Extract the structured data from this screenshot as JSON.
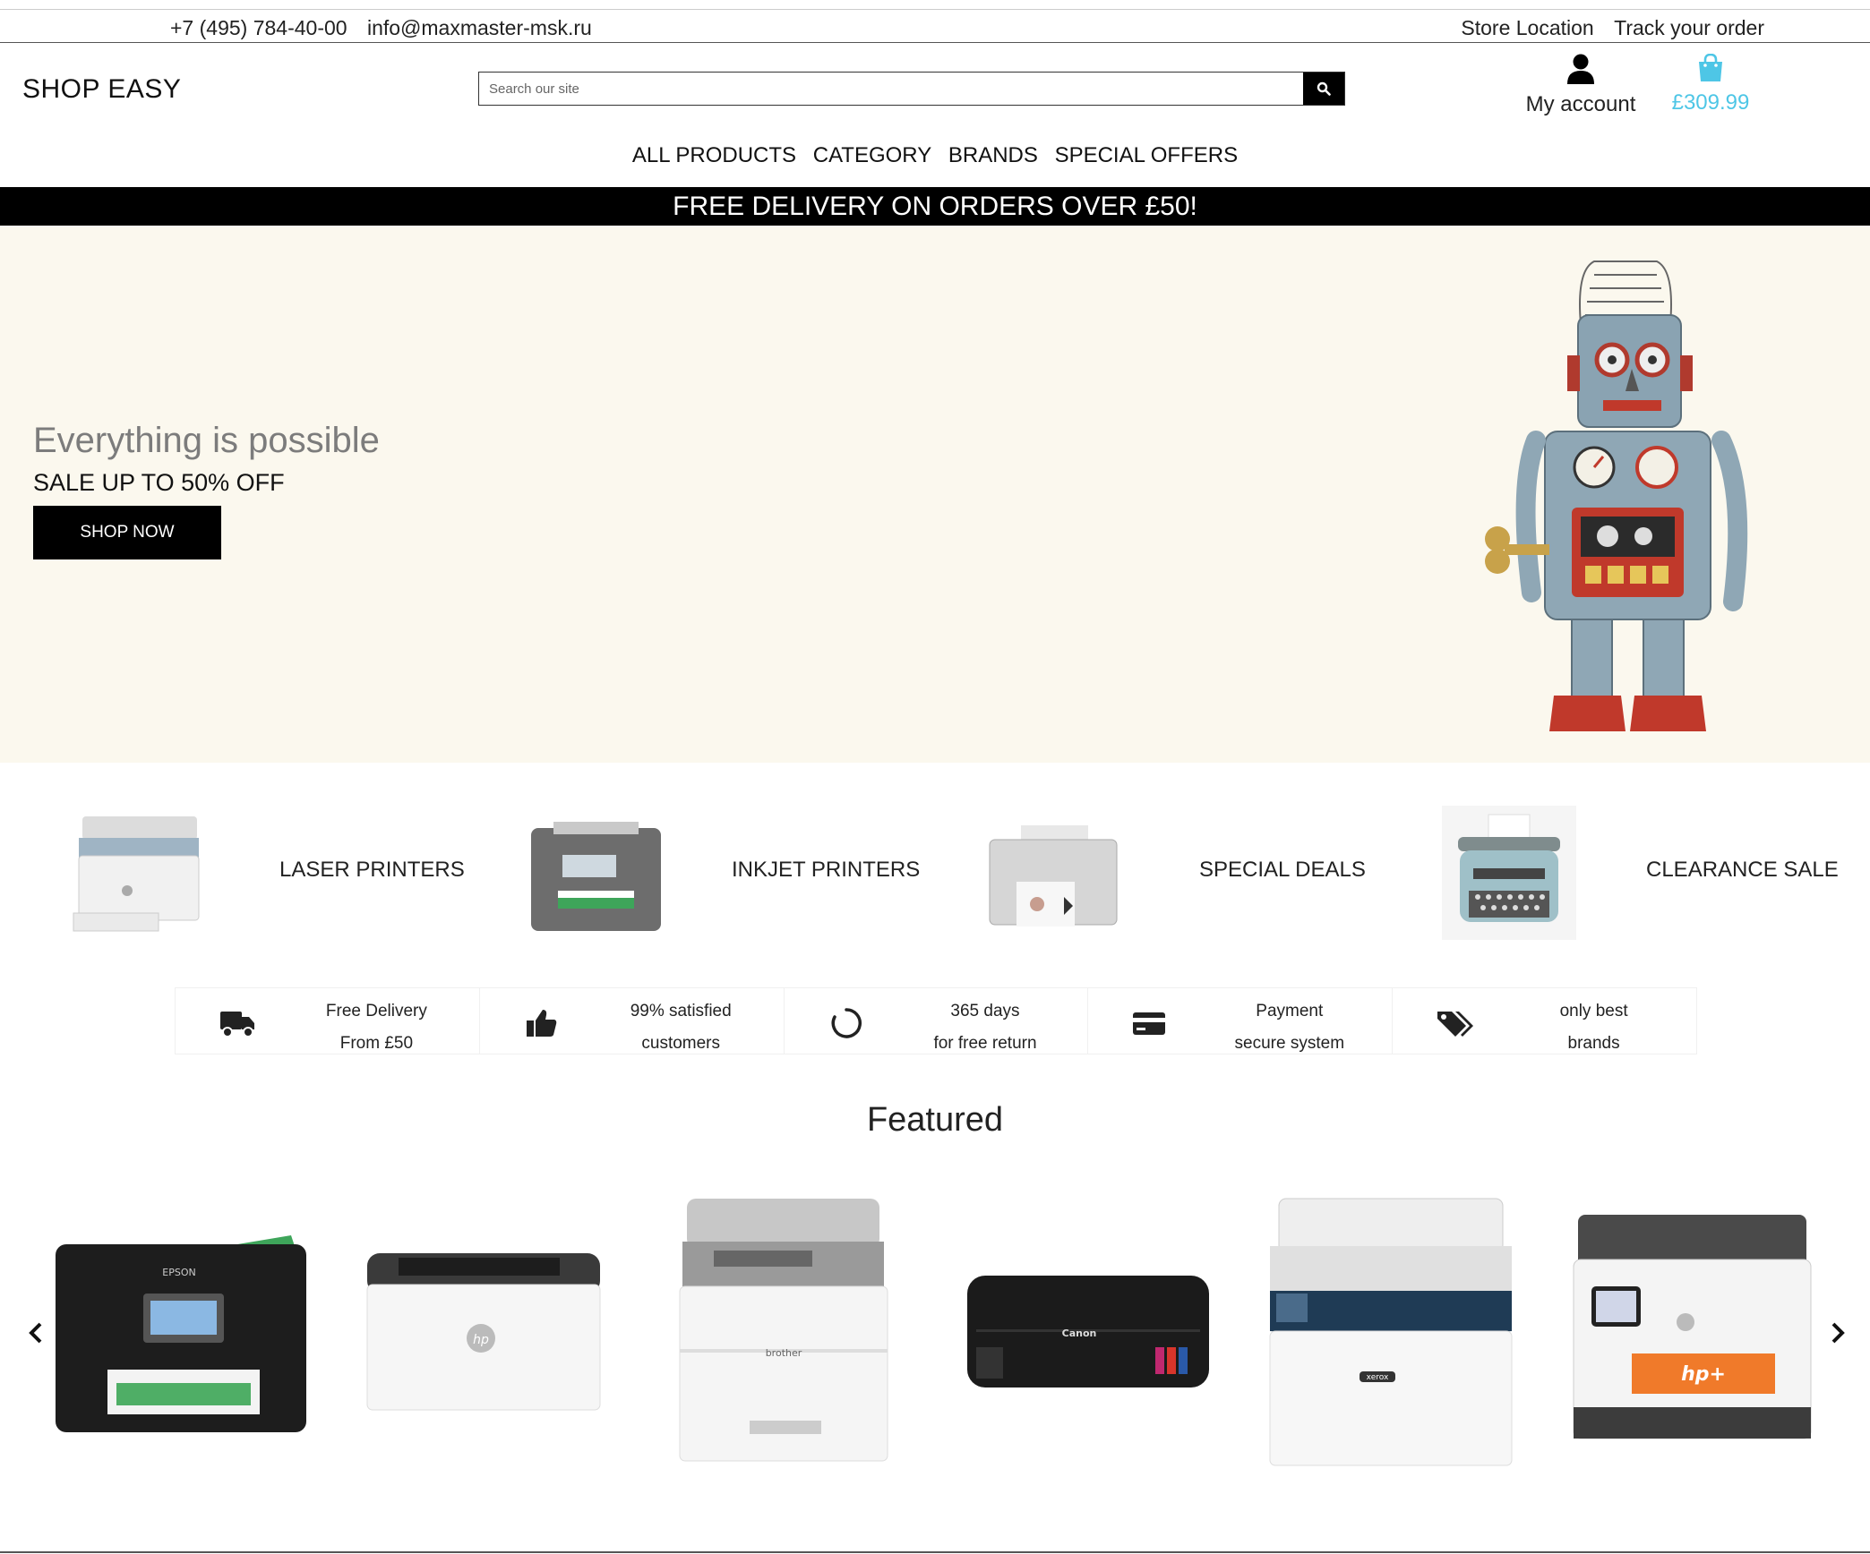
{
  "topbar": {
    "phone": "+7 (495) 784-40-00",
    "email": "info@maxmaster-msk.ru",
    "store_location": "Store Location",
    "track_order": "Track your order"
  },
  "header": {
    "logo": "SHOP EASY",
    "search_placeholder": "Search our site",
    "account_label": "My account",
    "cart_total": "£309.99"
  },
  "nav": [
    "ALL PRODUCTS",
    "CATEGORY",
    "BRANDS",
    "SPECIAL OFFERS"
  ],
  "promo_banner": "FREE DELIVERY ON ORDERS OVER £50!",
  "hero": {
    "headline": "Everything is possible",
    "subheadline": "SALE UP TO 50% OFF",
    "cta": "SHOP NOW"
  },
  "categories": [
    {
      "label": "LASER PRINTERS",
      "icon": "laser-printer-image"
    },
    {
      "label": "INKJET PRINTERS",
      "icon": "inkjet-printer-image"
    },
    {
      "label": "SPECIAL DEALS",
      "icon": "label-printer-image"
    },
    {
      "label": "CLEARANCE SALE",
      "icon": "typewriter-image"
    }
  ],
  "features": [
    {
      "line1": "Free Delivery",
      "line2": "From £50",
      "icon": "truck-icon"
    },
    {
      "line1": "99% satisfied",
      "line2": "customers",
      "icon": "thumbs-up-icon"
    },
    {
      "line1": "365 days",
      "line2": "for free return",
      "icon": "circle-return-icon"
    },
    {
      "line1": "Payment",
      "line2": "secure system",
      "icon": "credit-card-icon"
    },
    {
      "line1": "only best",
      "line2": "brands",
      "icon": "tags-icon"
    }
  ],
  "featured_title": "Featured",
  "products": [
    {
      "brand": "EPSON"
    },
    {
      "brand": "hp"
    },
    {
      "brand": "brother"
    },
    {
      "brand": "Canon"
    },
    {
      "brand": "xerox"
    },
    {
      "brand": "hp+"
    }
  ],
  "colors": {
    "accent": "#4ec6e6",
    "hero_bg": "#fbf8ee",
    "promo_bg": "#000000"
  }
}
